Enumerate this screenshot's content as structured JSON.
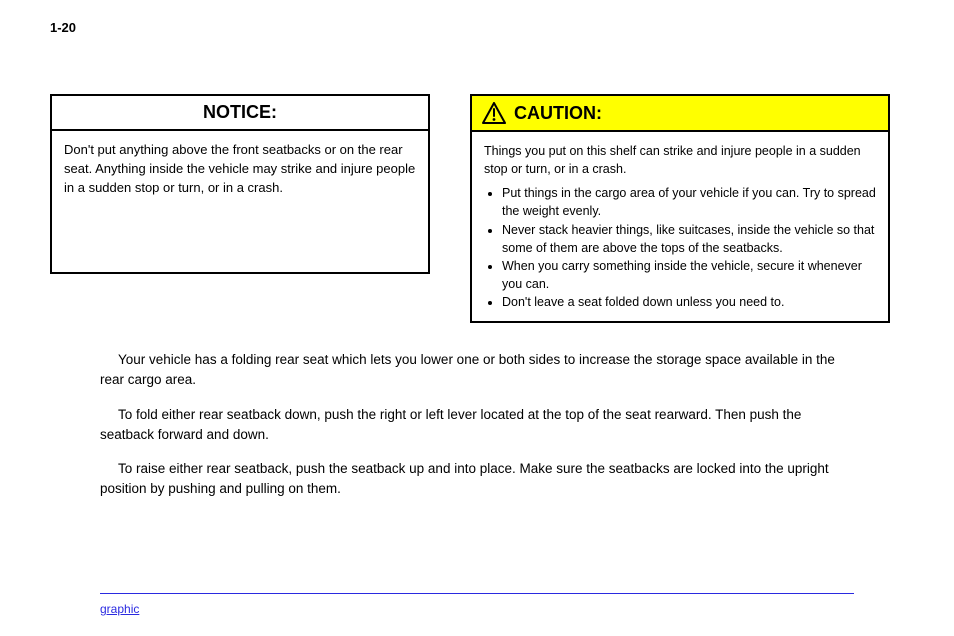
{
  "page_number": "1-20",
  "notice_box": {
    "header": "NOTICE:",
    "body": "Don't put anything above the front seatbacks or on the rear seat. Anything inside the vehicle may strike and injure people in a sudden stop or turn, or in a crash."
  },
  "caution_box": {
    "header": "CAUTION:",
    "body_lead": "Things you put on this shelf can strike and injure people in a sudden stop or turn, or in a crash.",
    "body_bullets": [
      "Put things in the cargo area of your vehicle if you can. Try to spread the weight evenly.",
      "Never stack heavier things, like suitcases, inside the vehicle so that some of them are above the tops of the seatbacks.",
      "When you carry something inside the vehicle, secure it whenever you can.",
      "Don't leave a seat folded down unless you need to."
    ]
  },
  "paragraphs": [
    "Your vehicle has a folding rear seat which lets you lower one or both sides to increase the storage space available in the rear cargo area.",
    "To fold either rear seatback down, push the right or left lever located at the top of the seat rearward. Then push the seatback forward and down.",
    "To raise either rear seatback, push the seatback up and into place. Make sure the seatbacks are locked into the upright position by pushing and pulling on them."
  ],
  "footer_link_label": "graphic"
}
